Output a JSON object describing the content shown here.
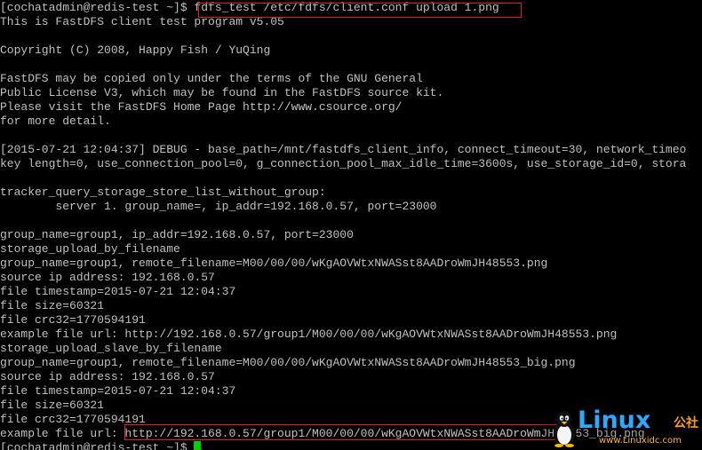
{
  "terminal": {
    "prompt": "[cochatadmin@redis-test ~]$ ",
    "command": "fdfs_test /etc/fdfs/client.conf upload 1.png",
    "lines": [
      "This is FastDFS client test program v5.05",
      "",
      "Copyright (C) 2008, Happy Fish / YuQing",
      "",
      "FastDFS may be copied only under the terms of the GNU General",
      "Public License V3, which may be found in the FastDFS source kit.",
      "Please visit the FastDFS Home Page http://www.csource.org/",
      "for more detail.",
      "",
      "[2015-07-21 12:04:37] DEBUG - base_path=/mnt/fastdfs_client_info, connect_timeout=30, network_timeo",
      "key length=0, use_connection_pool=0, g_connection_pool_max_idle_time=3600s, use_storage_id=0, stora",
      "",
      "tracker_query_storage_store_list_without_group:",
      "        server 1. group_name=, ip_addr=192.168.0.57, port=23000",
      "",
      "group_name=group1, ip_addr=192.168.0.57, port=23000",
      "storage_upload_by_filename",
      "group_name=group1, remote_filename=M00/00/00/wKgAOVWtxNWASst8AADroWmJH48553.png",
      "source ip address: 192.168.0.57",
      "file timestamp=2015-07-21 12:04:37",
      "file size=60321",
      "file crc32=1770594191",
      "example file url: http://192.168.0.57/group1/M00/00/00/wKgAOVWtxNWASst8AADroWmJH48553.png",
      "storage_upload_slave_by_filename",
      "group_name=group1, remote_filename=M00/00/00/wKgAOVWtxNWASst8AADroWmJH48553_big.png",
      "source ip address: 192.168.0.57",
      "file timestamp=2015-07-21 12:04:37",
      "file size=60321",
      "file crc32=1770594191",
      "example file url: http://192.168.0.57/group1/M00/00/00/wKgAOVWtxNWASst8AADroWmJH48553_big.png"
    ],
    "final_prompt": "[cochatadmin@redis-test ~]$ "
  },
  "watermark": {
    "brand": "Linux",
    "suffix": "公社",
    "url": "www.Linuxidc.com"
  },
  "colors": {
    "background": "#000000",
    "text": "#c0c0c0",
    "cursor": "#00d000",
    "highlight": "#e02020",
    "brand": "#2fa8ff",
    "brand_suffix": "#ff9a1f"
  }
}
